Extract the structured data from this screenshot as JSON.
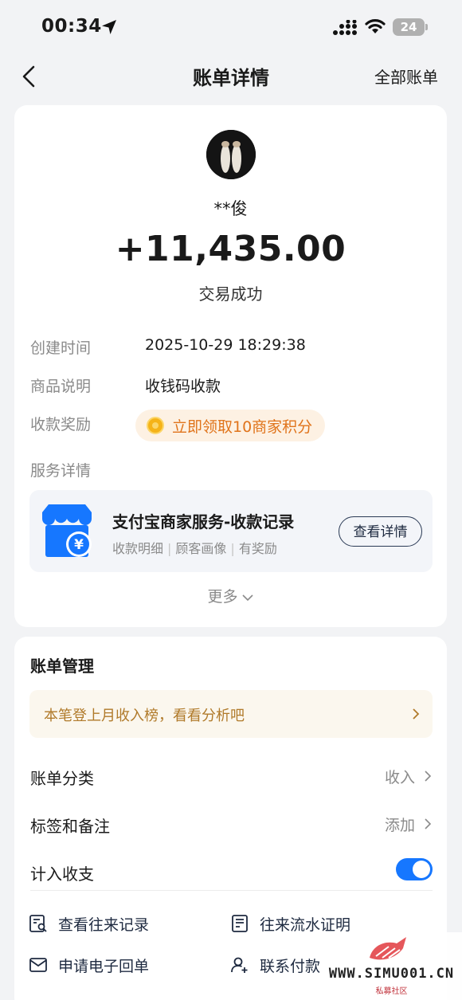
{
  "status_bar": {
    "time": "00:34",
    "battery": "24"
  },
  "nav": {
    "title": "账单详情",
    "right_link": "全部账单"
  },
  "transaction": {
    "payer": "**俊",
    "amount": "+11,435.00",
    "status": "交易成功"
  },
  "details": {
    "created_label": "创建时间",
    "created_value": "2025-10-29 18:29:38",
    "item_label": "商品说明",
    "item_value": "收钱码收款",
    "reward_label": "收款奖励",
    "reward_value": "立即领取10商家积分",
    "service_label": "服务详情"
  },
  "service_card": {
    "title": "支付宝商家服务-收款记录",
    "tags": [
      "收款明细",
      "顾客画像",
      "有奖励"
    ],
    "button": "查看详情"
  },
  "more_label": "更多",
  "management": {
    "title": "账单管理",
    "banner": "本笔登上月收入榜，看看分析吧",
    "category_label": "账单分类",
    "category_value": "收入",
    "tags_label": "标签和备注",
    "tags_value": "添加",
    "include_label": "计入收支",
    "include_on": true
  },
  "actions": {
    "history": "查看往来记录",
    "proof": "往来流水证明",
    "receipt": "申请电子回单",
    "contact": "联系付款"
  },
  "watermark": {
    "text": "WWW.SIMU001.CN",
    "sub": "私募社区"
  },
  "colors": {
    "accent": "#1677ff",
    "reward": "#e0741b",
    "banner_text": "#b07a2a"
  }
}
